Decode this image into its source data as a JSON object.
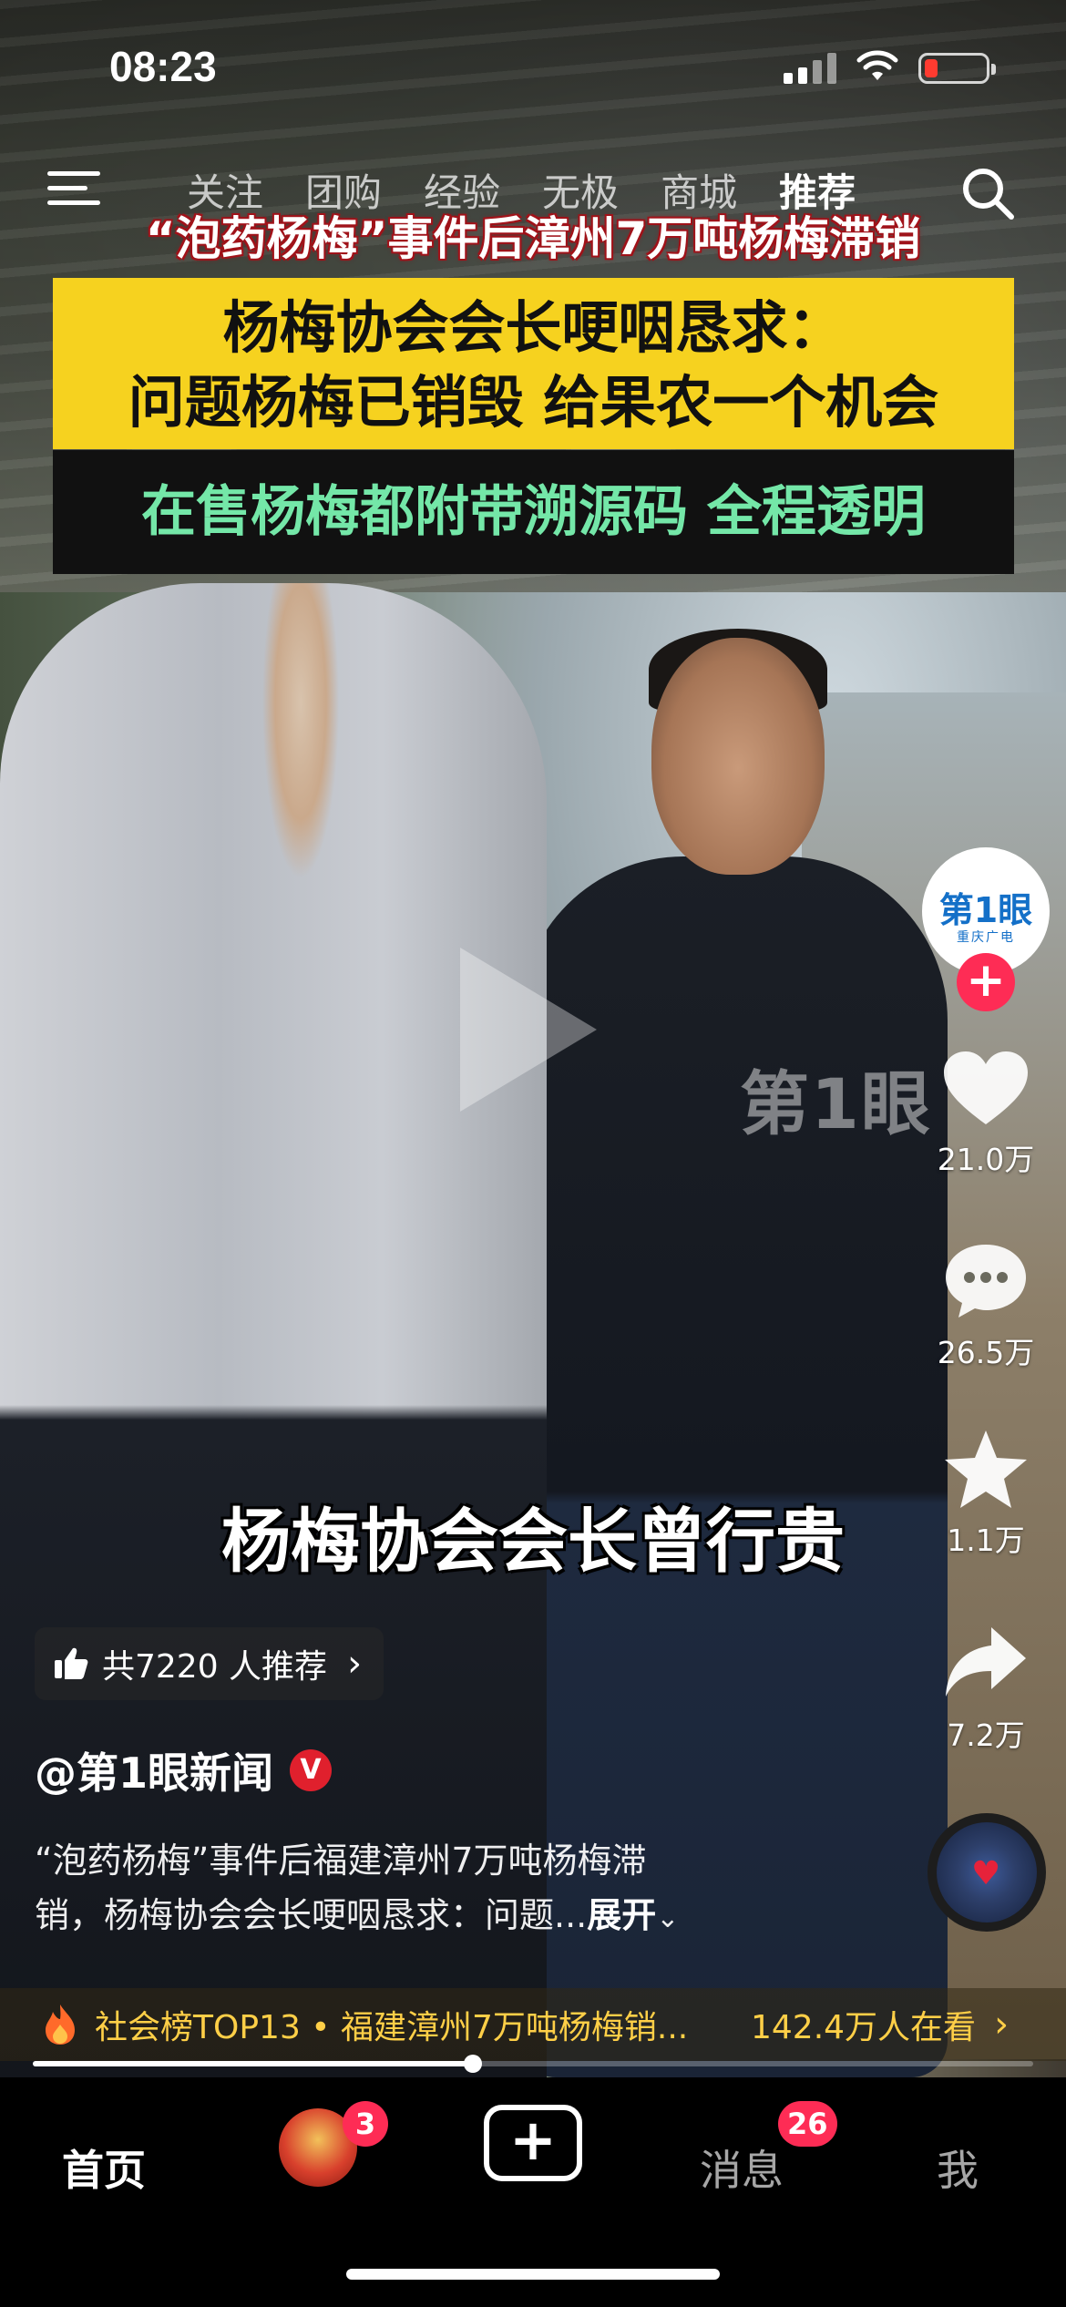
{
  "status_bar": {
    "time": "08:23"
  },
  "top_nav": {
    "tabs": [
      "关注",
      "团购",
      "经验",
      "无极",
      "商城",
      "推荐"
    ],
    "active_tab": "推荐"
  },
  "video": {
    "headline": "“泡药杨梅”事件后漳州7万吨杨梅滞销",
    "yellow_line1": "杨梅协会会长哽咽恳求：",
    "yellow_line2": "问题杨梅已销毁 给果农一个机会",
    "green_line": "在售杨梅都附带溯源码 全程透明",
    "subtitle": "杨梅协会会长曾行贵",
    "watermark": "第1眼"
  },
  "rail": {
    "avatar_logo": "第1眼",
    "avatar_sub": "重庆广电",
    "likes": "21.0万",
    "comments": "26.5万",
    "favorites": "1.1万",
    "shares": "7.2万"
  },
  "recommend": {
    "label": "共7220 人推荐"
  },
  "author": {
    "name": "@第1眼新闻",
    "verified_mark": "V"
  },
  "caption": {
    "line1": "“泡药杨梅”事件后福建漳州7万吨杨梅滞",
    "line2": "销，杨梅协会会长哽咽恳求：问题...",
    "expand": "展开"
  },
  "hotbar": {
    "text": "社会榜TOP13 • 福建漳州7万吨杨梅销...",
    "views": "142.4万人在看"
  },
  "playback": {
    "progress": 0.44
  },
  "bottom_bar": {
    "home": "首页",
    "friends_badge": "3",
    "messages": "消息",
    "messages_badge": "26",
    "me": "我"
  },
  "colors": {
    "accent_red": "#fe2c55",
    "headline_box": "#f6d21f",
    "green_text": "#74e7a8",
    "hot_yellow": "#ffcf47"
  }
}
